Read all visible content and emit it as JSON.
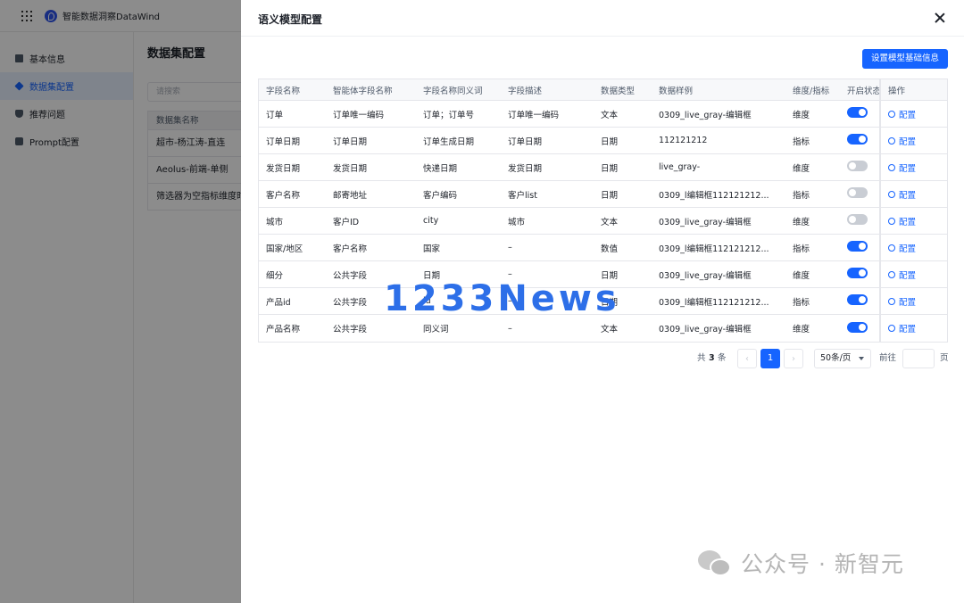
{
  "app": {
    "brand_name": "智能数据洞察DataWind",
    "sidebar": [
      {
        "label": "基本信息",
        "active": false
      },
      {
        "label": "数据集配置",
        "active": true
      },
      {
        "label": "推荐问题",
        "active": false
      },
      {
        "label": "Prompt配置",
        "active": false
      }
    ],
    "content_title": "数据集配置",
    "search_placeholder": "请搜索",
    "dataset_header": "数据集名称",
    "datasets": [
      "超市-杨江涛-直连",
      "Aeolus-前端-单侧",
      "筛选器为空指标维度时"
    ]
  },
  "drawer": {
    "title": "语义模型配置",
    "primary_button": "设置模型基础信息",
    "columns": [
      "字段名称",
      "智能体字段名称",
      "字段名称同义词",
      "字段描述",
      "数据类型",
      "数据样例",
      "维度/指标",
      "开启状态",
      "操作"
    ],
    "rows": [
      {
        "name": "订单",
        "agent": "订单唯一编码",
        "syn": "订单；订单号",
        "desc": "订单唯一编码",
        "type": "文本",
        "sample": "0309_live_gray-编辑框",
        "dim": "维度",
        "on": true,
        "op": "配置"
      },
      {
        "name": "订单日期",
        "agent": "订单日期",
        "syn": "订单生成日期",
        "desc": "订单日期",
        "type": "日期",
        "sample": "112121212",
        "dim": "指标",
        "on": true,
        "op": "配置"
      },
      {
        "name": "发货日期",
        "agent": "发货日期",
        "syn": "快递日期",
        "desc": "发货日期",
        "type": "日期",
        "sample": "live_gray-",
        "dim": "维度",
        "on": false,
        "op": "配置"
      },
      {
        "name": "客户名称",
        "agent": "邮寄地址",
        "syn": "客户编码",
        "desc": "客户list",
        "type": "日期",
        "sample": "0309_l编辑框112121212...",
        "dim": "指标",
        "on": false,
        "op": "配置"
      },
      {
        "name": "城市",
        "agent": "客户ID",
        "syn": "city",
        "desc": "城市",
        "type": "文本",
        "sample": "0309_live_gray-编辑框",
        "dim": "维度",
        "on": false,
        "op": "配置"
      },
      {
        "name": "国家/地区",
        "agent": "客户名称",
        "syn": "国家",
        "desc": "–",
        "type": "数值",
        "sample": "0309_l编辑框112121212...",
        "dim": "指标",
        "on": true,
        "op": "配置"
      },
      {
        "name": "细分",
        "agent": "公共字段",
        "syn": "日期",
        "desc": "–",
        "type": "日期",
        "sample": "0309_live_gray-编辑框",
        "dim": "维度",
        "on": true,
        "op": "配置"
      },
      {
        "name": "产品id",
        "agent": "公共字段",
        "syn": "id",
        "desc": "–",
        "type": "日期",
        "sample": "0309_l编辑框112121212...",
        "dim": "指标",
        "on": true,
        "op": "配置"
      },
      {
        "name": "产品名称",
        "agent": "公共字段",
        "syn": "同义词",
        "desc": "–",
        "type": "文本",
        "sample": "0309_live_gray-编辑框",
        "dim": "维度",
        "on": true,
        "op": "配置"
      }
    ],
    "pagination": {
      "total_prefix": "共",
      "total": "3",
      "total_suffix": "条",
      "current": "1",
      "page_size": "50条/页",
      "goto_prefix": "前往",
      "goto_suffix": "页"
    }
  },
  "watermarks": {
    "overlay": "1233News",
    "source": "公众号 · 新智元"
  }
}
